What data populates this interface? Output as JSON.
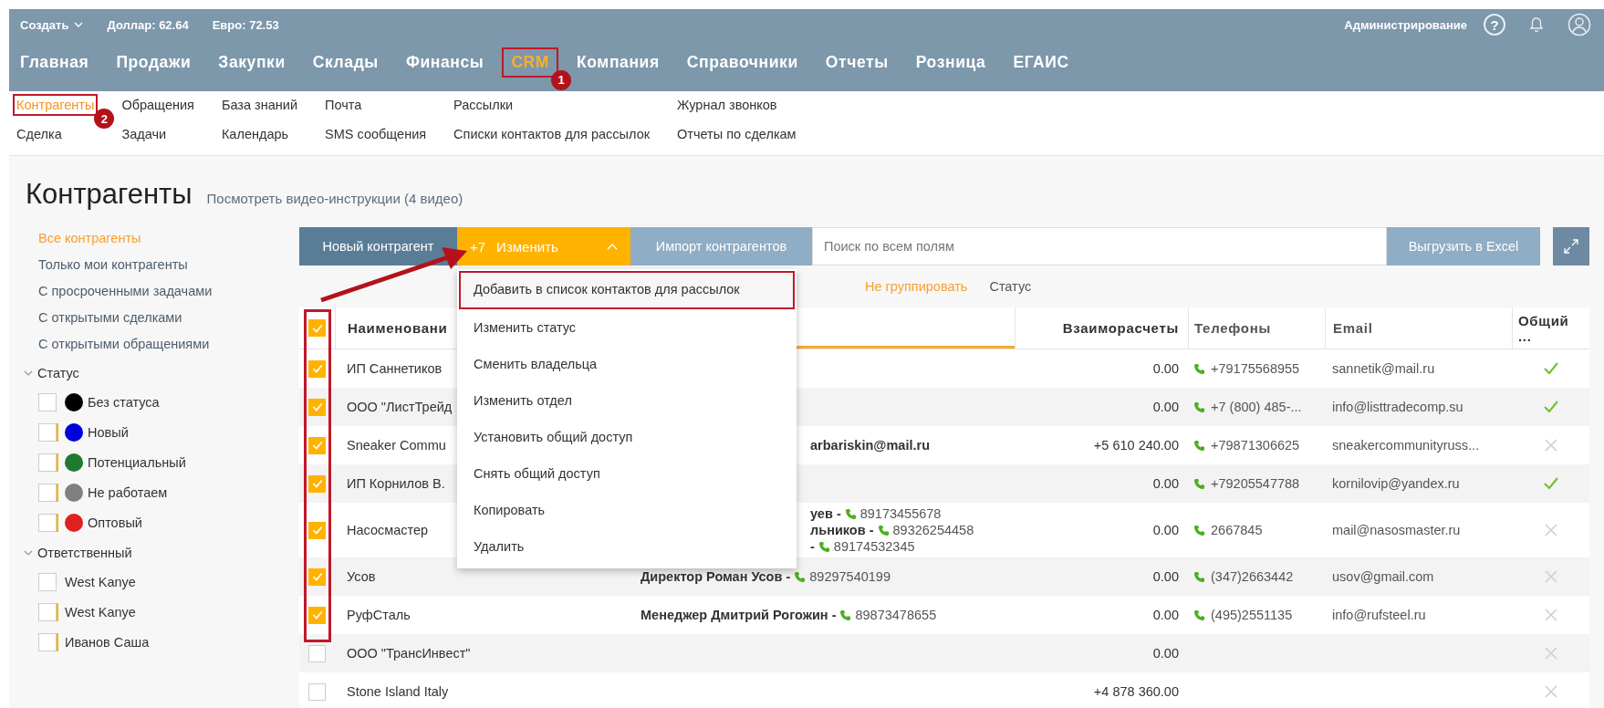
{
  "topbar": {
    "create_label": "Создать",
    "rates": [
      "Доллар: 62.64",
      "Евро: 72.53"
    ],
    "admin_label": "Администрирование",
    "help_label": "?"
  },
  "nav": [
    {
      "label": "Главная",
      "selected": false,
      "highlighted": false
    },
    {
      "label": "Продажи",
      "selected": false,
      "highlighted": false
    },
    {
      "label": "Закупки",
      "selected": false,
      "highlighted": false
    },
    {
      "label": "Склады",
      "selected": false,
      "highlighted": false
    },
    {
      "label": "Финансы",
      "selected": false,
      "highlighted": false
    },
    {
      "label": "CRM",
      "selected": true,
      "highlighted": true,
      "badge": "1"
    },
    {
      "label": "Компания",
      "selected": false,
      "highlighted": false
    },
    {
      "label": "Справочники",
      "selected": false,
      "highlighted": false
    },
    {
      "label": "Отчеты",
      "selected": false,
      "highlighted": false
    },
    {
      "label": "Розница",
      "selected": false,
      "highlighted": false
    },
    {
      "label": "ЕГАИС",
      "selected": false,
      "highlighted": false
    }
  ],
  "subnav": [
    [
      {
        "label": "Контрагенты",
        "selected": true,
        "highlighted": true,
        "badge": "2"
      },
      {
        "label": "Сделка",
        "selected": false,
        "highlighted": false
      }
    ],
    [
      {
        "label": "Обращения",
        "selected": false,
        "highlighted": false
      },
      {
        "label": "Задачи",
        "selected": false,
        "highlighted": false
      }
    ],
    [
      {
        "label": "База знаний",
        "selected": false,
        "highlighted": false
      },
      {
        "label": "Календарь",
        "selected": false,
        "highlighted": false
      }
    ],
    [
      {
        "label": "Почта",
        "selected": false,
        "highlighted": false
      },
      {
        "label": "SMS сообщения",
        "selected": false,
        "highlighted": false
      }
    ],
    [
      {
        "label": "Рассылки",
        "selected": false,
        "highlighted": false
      },
      {
        "label": "Списки контактов для рассылок",
        "selected": false,
        "highlighted": false
      }
    ],
    [
      {
        "label": "Журнал звонков",
        "selected": false,
        "highlighted": false
      },
      {
        "label": "Отчеты по сделкам",
        "selected": false,
        "highlighted": false
      }
    ]
  ],
  "page": {
    "title": "Контрагенты",
    "video_link": "Посмотреть видео-инструкции (4 видео)"
  },
  "sidebar": {
    "filters": [
      {
        "label": "Все контрагенты",
        "selected": true
      },
      {
        "label": "Только мои контрагенты",
        "selected": false
      },
      {
        "label": "С просроченными задачами",
        "selected": false
      },
      {
        "label": "С открытыми сделками",
        "selected": false
      },
      {
        "label": "С открытыми обращениями",
        "selected": false
      }
    ],
    "groups": [
      {
        "title": "Статус",
        "expanded": true,
        "items": [
          {
            "label": "Без статуса",
            "checked": false,
            "flagged": false,
            "color": "#000000"
          },
          {
            "label": "Новый",
            "checked": false,
            "flagged": true,
            "color": "#0000dd"
          },
          {
            "label": "Потенциальный",
            "checked": false,
            "flagged": true,
            "color": "#1e7a2e"
          },
          {
            "label": "Не работаем",
            "checked": false,
            "flagged": true,
            "color": "#808080"
          },
          {
            "label": "Оптовый",
            "checked": false,
            "flagged": true,
            "color": "#e02020"
          }
        ]
      },
      {
        "title": "Ответственный",
        "expanded": true,
        "items": [
          {
            "label": "West Kanye",
            "checked": false,
            "flagged": false
          },
          {
            "label": "West Kanye",
            "checked": false,
            "flagged": true
          },
          {
            "label": "Иванов Саша",
            "checked": false,
            "flagged": true
          }
        ]
      }
    ]
  },
  "toolbar": {
    "new_button": "Новый контрагент",
    "change_count": "+7",
    "change_button": "Изменить",
    "change_open": true,
    "import_button": "Импорт контрагентов",
    "search": {
      "placeholder": "Поиск по всем полям"
    },
    "export_button": "Выгрузить в Excel"
  },
  "change_menu": [
    {
      "label": "Добавить в список контактов для рассылок",
      "highlighted": true
    },
    {
      "label": "Изменить статус",
      "highlighted": false
    },
    {
      "label": "Сменить владельца",
      "highlighted": false
    },
    {
      "label": "Изменить отдел",
      "highlighted": false
    },
    {
      "label": "Установить общий доступ",
      "highlighted": false
    },
    {
      "label": "Снять общий доступ",
      "highlighted": false
    },
    {
      "label": "Копировать",
      "highlighted": false
    },
    {
      "label": "Удалить",
      "highlighted": false
    }
  ],
  "grouping": [
    {
      "label": "Не группировать",
      "selected": true
    },
    {
      "label": "Статус",
      "selected": false
    }
  ],
  "table": {
    "all_checked": true,
    "checkboxes_highlighted": true,
    "columns": [
      {
        "label": "Наименовани",
        "sorted": false
      },
      {
        "sorted": true
      },
      {
        "label": "Взаиморасчеты",
        "sorted": false
      },
      {
        "label": "Телефоны",
        "sorted": false
      },
      {
        "label": "Email",
        "sorted": false
      },
      {
        "label": "Общий ...",
        "sorted": false
      }
    ],
    "rows": [
      {
        "checked": true,
        "name": "ИП Саннетиков",
        "amount": "0.00",
        "phone": "+79175568955",
        "email": "sannetik@mail.ru",
        "shared": true
      },
      {
        "checked": true,
        "name": "ООО \"ЛистТрейд",
        "amount": "0.00",
        "phone": "+7 (800) 485-...",
        "email": "info@listtradecomp.su",
        "shared": true
      },
      {
        "checked": true,
        "name": "Sneaker Commu",
        "contacts_covered": true,
        "contacts": [
          {
            "text": "arbariskin@mail.ru"
          }
        ],
        "amount": "+5 610 240.00",
        "phone": "+79871306625",
        "email": "sneakercommunityruss...",
        "shared": false
      },
      {
        "checked": true,
        "name": "ИП Корнилов В.",
        "amount": "0.00",
        "phone": "+79205547788",
        "email": "kornilovip@yandex.ru",
        "shared": true
      },
      {
        "checked": true,
        "name": "Насосмастер",
        "contacts_covered": true,
        "contacts": [
          {
            "text": "уев -",
            "phone": "89173455678"
          },
          {
            "text": "льников -",
            "phone": "89326254458"
          },
          {
            "text": "-",
            "phone": "89174532345"
          }
        ],
        "amount": "0.00",
        "phone": "2667845",
        "email": "mail@nasosmaster.ru",
        "shared": false
      },
      {
        "checked": true,
        "name": "Усов",
        "contacts_covered": false,
        "contacts": [
          {
            "text": "Директор Роман Усов -",
            "phone": "89297540199"
          }
        ],
        "amount": "0.00",
        "phone": "(347)2663442",
        "email": "usov@gmail.com",
        "shared": false
      },
      {
        "checked": true,
        "name": "РуфСталь",
        "contacts_covered": false,
        "contacts": [
          {
            "text": "Менеджер Дмитрий Рогожин -",
            "phone": "89873478655"
          }
        ],
        "amount": "0.00",
        "phone": "(495)2551135",
        "email": "info@rufsteel.ru",
        "shared": false
      },
      {
        "checked": false,
        "name": "ООО \"ТрансИнвест\"",
        "amount": "0.00",
        "shared": false
      },
      {
        "checked": false,
        "name": "Stone Island Italy",
        "amount": "+4 878 360.00",
        "shared": false
      }
    ]
  }
}
